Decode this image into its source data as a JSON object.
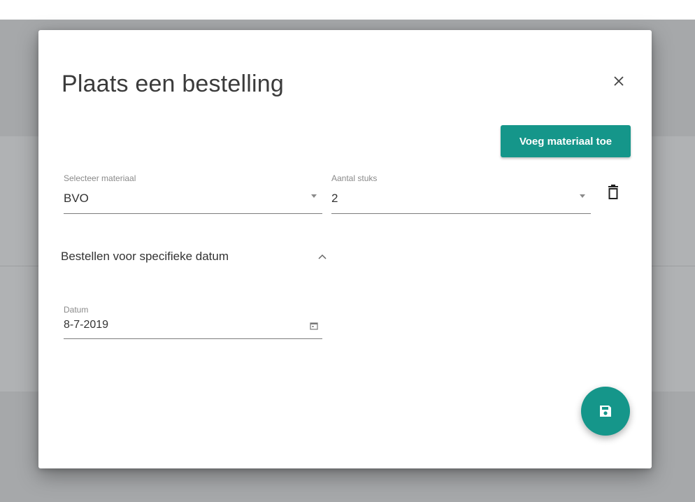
{
  "dialog": {
    "title": "Plaats een bestelling",
    "close_icon": "close-icon",
    "add_material_label": "Voeg materiaal toe",
    "material_field": {
      "label": "Selecteer materiaal",
      "value": "BVO"
    },
    "quantity_field": {
      "label": "Aantal stuks",
      "value": "2"
    },
    "delete_icon": "trash-icon",
    "section": {
      "title": "Bestellen voor specifieke datum",
      "expanded": true,
      "chevron_icon": "chevron-up-icon"
    },
    "date_field": {
      "label": "Datum",
      "value": "8-7-2019",
      "icon": "calendar-icon"
    },
    "save_icon": "save-icon"
  },
  "colors": {
    "accent": "#15968a",
    "backdrop": "#a6a8aa",
    "dialog_bg": "#ffffff"
  }
}
